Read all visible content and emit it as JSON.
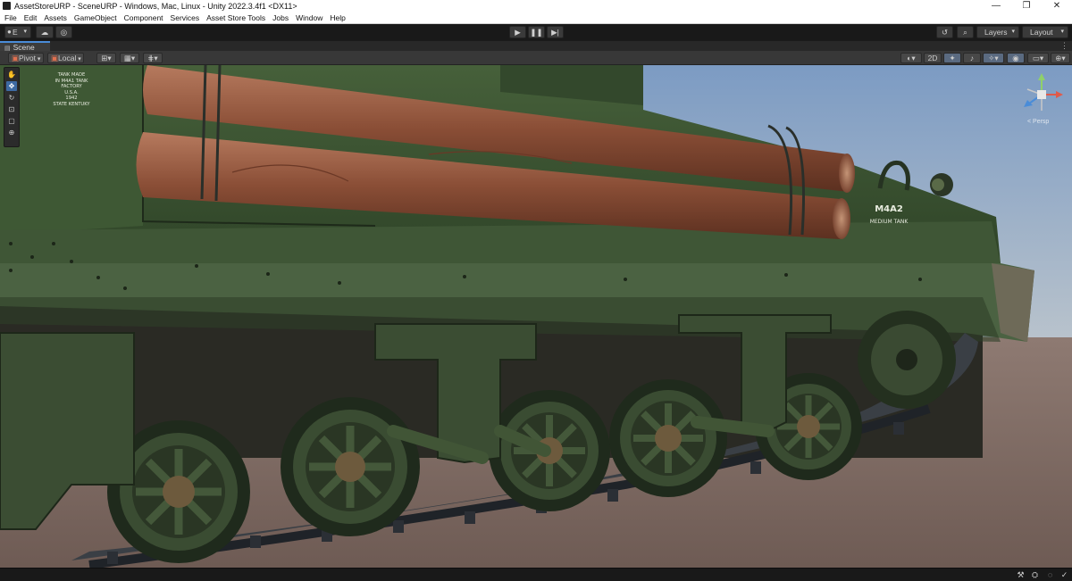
{
  "window": {
    "title": "AssetStoreURP - SceneURP - Windows, Mac, Linux - Unity 2022.3.4f1 <DX11>",
    "minimize": "—",
    "maximize": "❐",
    "close": "✕"
  },
  "menu": [
    "File",
    "Edit",
    "Assets",
    "GameObject",
    "Component",
    "Services",
    "Asset Store Tools",
    "Jobs",
    "Window",
    "Help"
  ],
  "toolbar": {
    "account_label": "E",
    "account_icon": "account-icon",
    "cloud_icon": "cloud-icon",
    "collab_icon": "collab-icon",
    "play_icon": "▶",
    "pause_icon": "❚❚",
    "step_icon": "▶|",
    "history_icon": "history-icon",
    "search_icon": "search-icon",
    "layers_label": "Layers",
    "layout_label": "Layout"
  },
  "scene_tab": {
    "label": "Scene",
    "menu_glyph": "⋮"
  },
  "scene_toolbar": {
    "pivot_label": "Pivot",
    "local_label": "Local",
    "mode_2d_label": "2D"
  },
  "tools": [
    "hand-tool",
    "move-tool",
    "rotate-tool",
    "scale-tool",
    "rect-tool",
    "transform-tool"
  ],
  "decals": {
    "plate_lines": [
      "TANK MADE",
      "IN M4A1 TANK",
      "FACTORY",
      "U.S.A.",
      "1942",
      "STATE KENTUKY"
    ],
    "model": "M4A2",
    "model_sub": "MEDIUM TANK"
  },
  "gizmo": {
    "label": "< Persp"
  },
  "colors": {
    "tank_green": "#3c5230",
    "tank_green_dark": "#243322",
    "sky_top": "#7c9bc3",
    "sky_bottom": "#b7c2cb",
    "ground": "#7e6a63",
    "wood": "#9a5a40",
    "accent_blue": "#4a8cd8"
  }
}
